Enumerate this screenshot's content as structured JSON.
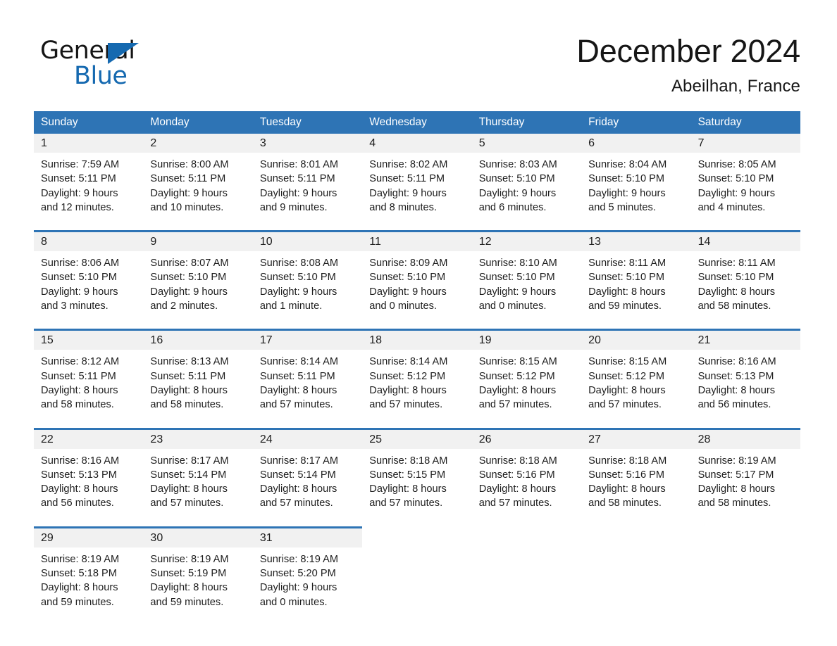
{
  "brand": {
    "name_part1": "General",
    "name_part2": "Blue",
    "triangle_icon": "brand-triangle-icon",
    "accent_color": "#1569b0"
  },
  "header": {
    "month_title": "December 2024",
    "location": "Abeilhan, France"
  },
  "theme": {
    "header_blue": "#2e74b5",
    "row_rule_blue": "#2e74b5",
    "daynum_band": "#f1f1f1",
    "text": "#1d1d1d"
  },
  "weekdays": [
    "Sunday",
    "Monday",
    "Tuesday",
    "Wednesday",
    "Thursday",
    "Friday",
    "Saturday"
  ],
  "weeks": [
    [
      {
        "day": "1",
        "lines": [
          "Sunrise: 7:59 AM",
          "Sunset: 5:11 PM",
          "Daylight: 9 hours",
          "and 12 minutes."
        ]
      },
      {
        "day": "2",
        "lines": [
          "Sunrise: 8:00 AM",
          "Sunset: 5:11 PM",
          "Daylight: 9 hours",
          "and 10 minutes."
        ]
      },
      {
        "day": "3",
        "lines": [
          "Sunrise: 8:01 AM",
          "Sunset: 5:11 PM",
          "Daylight: 9 hours",
          "and 9 minutes."
        ]
      },
      {
        "day": "4",
        "lines": [
          "Sunrise: 8:02 AM",
          "Sunset: 5:11 PM",
          "Daylight: 9 hours",
          "and 8 minutes."
        ]
      },
      {
        "day": "5",
        "lines": [
          "Sunrise: 8:03 AM",
          "Sunset: 5:10 PM",
          "Daylight: 9 hours",
          "and 6 minutes."
        ]
      },
      {
        "day": "6",
        "lines": [
          "Sunrise: 8:04 AM",
          "Sunset: 5:10 PM",
          "Daylight: 9 hours",
          "and 5 minutes."
        ]
      },
      {
        "day": "7",
        "lines": [
          "Sunrise: 8:05 AM",
          "Sunset: 5:10 PM",
          "Daylight: 9 hours",
          "and 4 minutes."
        ]
      }
    ],
    [
      {
        "day": "8",
        "lines": [
          "Sunrise: 8:06 AM",
          "Sunset: 5:10 PM",
          "Daylight: 9 hours",
          "and 3 minutes."
        ]
      },
      {
        "day": "9",
        "lines": [
          "Sunrise: 8:07 AM",
          "Sunset: 5:10 PM",
          "Daylight: 9 hours",
          "and 2 minutes."
        ]
      },
      {
        "day": "10",
        "lines": [
          "Sunrise: 8:08 AM",
          "Sunset: 5:10 PM",
          "Daylight: 9 hours",
          "and 1 minute."
        ]
      },
      {
        "day": "11",
        "lines": [
          "Sunrise: 8:09 AM",
          "Sunset: 5:10 PM",
          "Daylight: 9 hours",
          "and 0 minutes."
        ]
      },
      {
        "day": "12",
        "lines": [
          "Sunrise: 8:10 AM",
          "Sunset: 5:10 PM",
          "Daylight: 9 hours",
          "and 0 minutes."
        ]
      },
      {
        "day": "13",
        "lines": [
          "Sunrise: 8:11 AM",
          "Sunset: 5:10 PM",
          "Daylight: 8 hours",
          "and 59 minutes."
        ]
      },
      {
        "day": "14",
        "lines": [
          "Sunrise: 8:11 AM",
          "Sunset: 5:10 PM",
          "Daylight: 8 hours",
          "and 58 minutes."
        ]
      }
    ],
    [
      {
        "day": "15",
        "lines": [
          "Sunrise: 8:12 AM",
          "Sunset: 5:11 PM",
          "Daylight: 8 hours",
          "and 58 minutes."
        ]
      },
      {
        "day": "16",
        "lines": [
          "Sunrise: 8:13 AM",
          "Sunset: 5:11 PM",
          "Daylight: 8 hours",
          "and 58 minutes."
        ]
      },
      {
        "day": "17",
        "lines": [
          "Sunrise: 8:14 AM",
          "Sunset: 5:11 PM",
          "Daylight: 8 hours",
          "and 57 minutes."
        ]
      },
      {
        "day": "18",
        "lines": [
          "Sunrise: 8:14 AM",
          "Sunset: 5:12 PM",
          "Daylight: 8 hours",
          "and 57 minutes."
        ]
      },
      {
        "day": "19",
        "lines": [
          "Sunrise: 8:15 AM",
          "Sunset: 5:12 PM",
          "Daylight: 8 hours",
          "and 57 minutes."
        ]
      },
      {
        "day": "20",
        "lines": [
          "Sunrise: 8:15 AM",
          "Sunset: 5:12 PM",
          "Daylight: 8 hours",
          "and 57 minutes."
        ]
      },
      {
        "day": "21",
        "lines": [
          "Sunrise: 8:16 AM",
          "Sunset: 5:13 PM",
          "Daylight: 8 hours",
          "and 56 minutes."
        ]
      }
    ],
    [
      {
        "day": "22",
        "lines": [
          "Sunrise: 8:16 AM",
          "Sunset: 5:13 PM",
          "Daylight: 8 hours",
          "and 56 minutes."
        ]
      },
      {
        "day": "23",
        "lines": [
          "Sunrise: 8:17 AM",
          "Sunset: 5:14 PM",
          "Daylight: 8 hours",
          "and 57 minutes."
        ]
      },
      {
        "day": "24",
        "lines": [
          "Sunrise: 8:17 AM",
          "Sunset: 5:14 PM",
          "Daylight: 8 hours",
          "and 57 minutes."
        ]
      },
      {
        "day": "25",
        "lines": [
          "Sunrise: 8:18 AM",
          "Sunset: 5:15 PM",
          "Daylight: 8 hours",
          "and 57 minutes."
        ]
      },
      {
        "day": "26",
        "lines": [
          "Sunrise: 8:18 AM",
          "Sunset: 5:16 PM",
          "Daylight: 8 hours",
          "and 57 minutes."
        ]
      },
      {
        "day": "27",
        "lines": [
          "Sunrise: 8:18 AM",
          "Sunset: 5:16 PM",
          "Daylight: 8 hours",
          "and 58 minutes."
        ]
      },
      {
        "day": "28",
        "lines": [
          "Sunrise: 8:19 AM",
          "Sunset: 5:17 PM",
          "Daylight: 8 hours",
          "and 58 minutes."
        ]
      }
    ],
    [
      {
        "day": "29",
        "lines": [
          "Sunrise: 8:19 AM",
          "Sunset: 5:18 PM",
          "Daylight: 8 hours",
          "and 59 minutes."
        ]
      },
      {
        "day": "30",
        "lines": [
          "Sunrise: 8:19 AM",
          "Sunset: 5:19 PM",
          "Daylight: 8 hours",
          "and 59 minutes."
        ]
      },
      {
        "day": "31",
        "lines": [
          "Sunrise: 8:19 AM",
          "Sunset: 5:20 PM",
          "Daylight: 9 hours",
          "and 0 minutes."
        ]
      },
      {
        "day": "",
        "lines": []
      },
      {
        "day": "",
        "lines": []
      },
      {
        "day": "",
        "lines": []
      },
      {
        "day": "",
        "lines": []
      }
    ]
  ]
}
